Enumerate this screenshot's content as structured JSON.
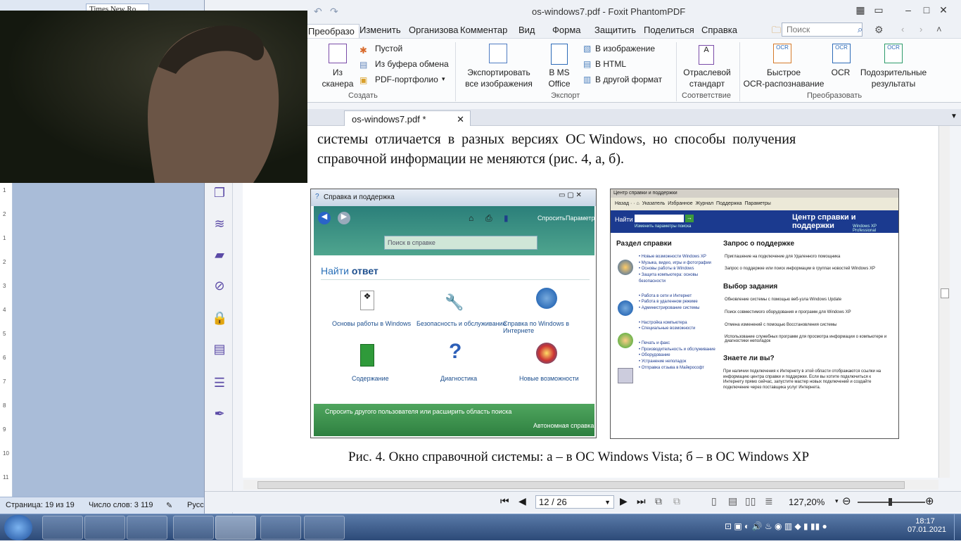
{
  "word": {
    "font": "Times New Ro",
    "status_page": "Страница: 19 из 19",
    "status_words": "Число слов: 3 119",
    "status_lang": "Русс",
    "ruler_nums": [
      "1",
      "2",
      "1",
      "2",
      "3",
      "4",
      "5",
      "6",
      "7",
      "8",
      "9",
      "10",
      "11"
    ]
  },
  "foxit": {
    "title": "os-windows7.pdf - Foxit PhantomPDF",
    "tabs": [
      "Преобразо",
      "Изменить",
      "Организова",
      "Комментар",
      "Вид",
      "Форма",
      "Защитить",
      "Поделиться",
      "Справка"
    ],
    "search_placeholder": "Поиск",
    "ribbon": {
      "from_scanner": "Из\nсканера",
      "blank": "Пустой",
      "from_clipboard": "Из буфера обмена",
      "pdf_portfolio": "PDF-портфолио",
      "group_create": "Создать",
      "export_images": "Экспортировать\nвсе изображения",
      "ms_office": "В MS\nOffice",
      "to_image": "В изображение",
      "to_html": "В HTML",
      "to_other": "В другой формат",
      "group_export": "Экспорт",
      "industry": "Отраслевой\nстандарт",
      "group_compliance": "Соответствие",
      "quick_ocr": "Быстрое\nOCR-распознавание",
      "ocr": "OCR",
      "suspect": "Подозрительные\nрезультаты",
      "group_convert": "Преобразовать"
    },
    "doc_tab": "os-windows7.pdf *",
    "page_nav": "12 / 26",
    "zoom": "127,20%"
  },
  "document": {
    "line1": "системы  отличается  в  разных  версиях  ОС Windows,  но  способы  получения",
    "line2": "справочной информации не меняются (рис. 4, а, б).",
    "caption": "Рис. 4. Окно справочной системы: а – в ОС Windows Vista; б – в ОС Windows XP"
  },
  "vista": {
    "title": "Справка и поддержка",
    "ask": "Спросить",
    "params": "Параметры",
    "search": "Поиск в справке",
    "find1": "Найти",
    "find2": "ответ",
    "items": [
      "Основы работы в Windows",
      "Безопасность и обслуживание",
      "Справка по Windows в Интернете",
      "Содержание",
      "Диагностика",
      "Новые возможности"
    ],
    "footer": "Спросить другого пользователя или расширить область поиска",
    "offline": "Автономная справка"
  },
  "xp": {
    "title": "Центр справки и поддержки",
    "toolbar": [
      "Назад",
      "Указатель",
      "Избранное",
      "Журнал",
      "Поддержка",
      "Параметры"
    ],
    "find": "Найти",
    "search_opts": "Изменить параметры поиска",
    "header": "Центр справки и поддержки",
    "edition": "Windows XP Professional",
    "sect_title": "Раздел справки",
    "sect_links": [
      "Новые возможности Windows XP",
      "Музыка, видео, игры и фотографии",
      "Основы работы в Windows",
      "Защита компьютера: основы безопасности",
      "Работа в сети и Интернет",
      "Работа в удаленном режиме",
      "Администрирование системы",
      "Настройка компьютера",
      "Специальные возможности",
      "Печать и факс",
      "Производительность и обслуживание",
      "Оборудование",
      "Устранение неполадок",
      "Отправка отзыва в Майкрософт"
    ],
    "support_title": "Запрос о поддержке",
    "support": [
      "Приглашение на подключение для Удаленного помощника",
      "Запрос о поддержке или поиск информации в группах новостей Windows XP"
    ],
    "task_title": "Выбор задания",
    "tasks": [
      "Обновление системы с помощью веб-узла Windows Update",
      "Поиск совместимого оборудования и программ для Windows XP",
      "Отмена изменений с помощью Восстановления системы",
      "Использование служебных программ для просмотра информации о компьютере и диагностики неполадок"
    ],
    "know_title": "Знаете ли вы?",
    "know": "При наличии подключения к Интернету в этой области отображаются ссылки на информацию центра справки и поддержки. Если вы хотите подключиться к Интернету прямо сейчас, запустите мастер новых подключений и создайте подключение через поставщика услуг Интернета."
  },
  "taskbar": {
    "time": "18:17",
    "date": "07.01.2021"
  }
}
